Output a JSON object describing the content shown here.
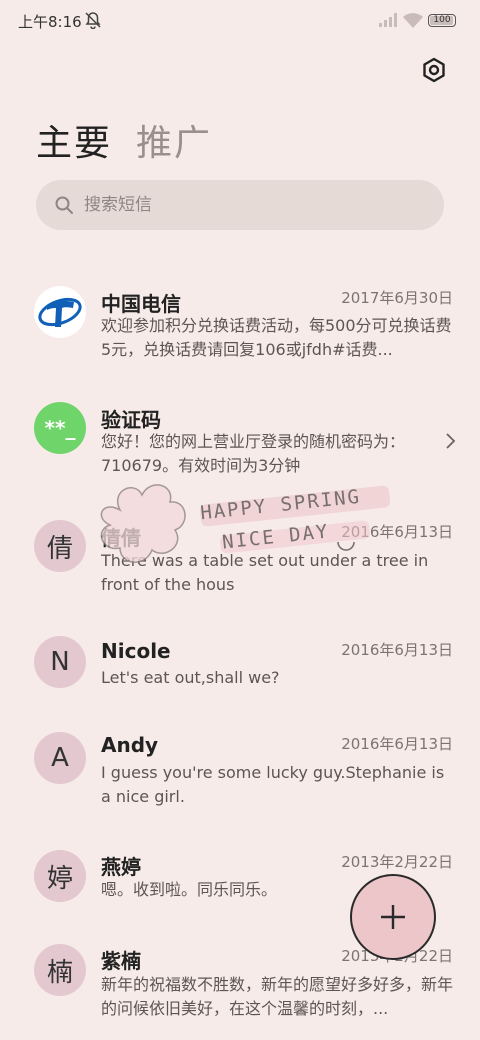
{
  "status_bar": {
    "time": "上午8:16",
    "battery": "100"
  },
  "tabs": [
    {
      "label": "主要",
      "active": true
    },
    {
      "label": "推广",
      "active": false
    }
  ],
  "search": {
    "placeholder": "搜索短信"
  },
  "conversations": [
    {
      "name": "中国电信",
      "date": "2017年6月30日",
      "preview": "欢迎参加积分兑换话费活动，每500分可兑换话费5元，兑换话费请回复106或jfdh#话费...",
      "avatar_type": "logo"
    },
    {
      "name": "验证码",
      "date": "",
      "preview": "您好！您的网上营业厅登录的随机密码为：710679。有效时间为3分钟",
      "avatar_text": "**_",
      "avatar_type": "code"
    },
    {
      "name": "倩倩",
      "date": "2016年6月13日",
      "preview": "There was a table set out under a tree in front of the hous",
      "avatar_text": "倩"
    },
    {
      "name": "Nicole",
      "date": "2016年6月13日",
      "preview": "Let's eat out,shall we?",
      "avatar_text": "N"
    },
    {
      "name": "Andy",
      "date": "2016年6月13日",
      "preview": "I guess you're some lucky guy.Stephanie is a nice girl.",
      "avatar_text": "A"
    },
    {
      "name": "燕婷",
      "date": "2013年2月22日",
      "preview": "嗯。收到啦。同乐同乐。",
      "avatar_text": "婷"
    },
    {
      "name": "紫楠",
      "date": "2013年2月22日",
      "preview": "新年的祝福数不胜数，新年的愿望好多好多，新年的问候依旧美好，在这个温馨的时刻，...",
      "avatar_text": "楠"
    }
  ],
  "sticker": {
    "line1": "HAPPY SPRING",
    "line2": "NICE DAY"
  },
  "colors": {
    "background": "#f6ebe8",
    "avatar": "#e3c8d0",
    "fab": "#ecc6c8",
    "code_avatar": "#6fd56a",
    "telecom_blue": "#1160b8"
  }
}
